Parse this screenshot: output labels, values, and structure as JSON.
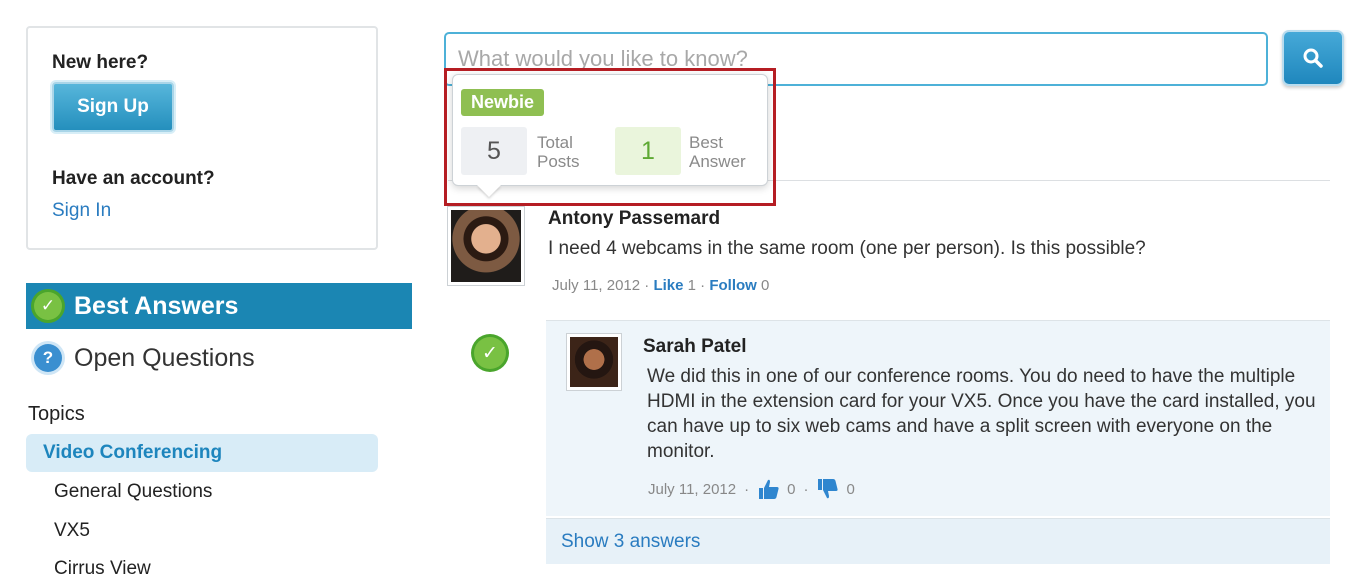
{
  "login": {
    "new_here": "New here?",
    "sign_up": "Sign Up",
    "have_account": "Have an account?",
    "sign_in": "Sign In"
  },
  "nav": {
    "best_answers": "Best Answers",
    "open_questions": "Open Questions"
  },
  "topics": {
    "heading": "Topics",
    "items": [
      "Video Conferencing",
      "General Questions",
      "VX5",
      "Cirrus View"
    ]
  },
  "search": {
    "placeholder": "What would you like to know?"
  },
  "hovercard": {
    "badge": "Newbie",
    "total_posts": "5",
    "total_posts_label_1": "Total",
    "total_posts_label_2": "Posts",
    "best_answer": "1",
    "best_answer_label_1": "Best",
    "best_answer_label_2": "Answer"
  },
  "question": {
    "author": "Antony Passemard",
    "body": "I need 4 webcams in the same room (one per person). Is this possible?",
    "date": "July 11, 2012",
    "sep": "·",
    "like_label": "Like",
    "like_count": "1",
    "follow_label": "Follow",
    "follow_count": "0"
  },
  "answer": {
    "author": "Sarah Patel",
    "body": "We did this in one of our conference rooms. You do need to have the multiple HDMI in the extension card for your VX5. Once you have the card installed, you can have up to six web cams and have a split screen with everyone on the monitor.",
    "date": "July 11, 2012",
    "sep": "·",
    "upvotes": "0",
    "downvotes": "0",
    "show_answers": "Show 3 answers"
  },
  "colors": {
    "accent_blue": "#1b86b3",
    "link_blue": "#2a7cc0",
    "check_green": "#79c143",
    "highlight_red": "#b51d23"
  },
  "icons": [
    "check-icon",
    "question-icon",
    "search-icon",
    "thumbs-up-icon",
    "thumbs-down-icon"
  ]
}
